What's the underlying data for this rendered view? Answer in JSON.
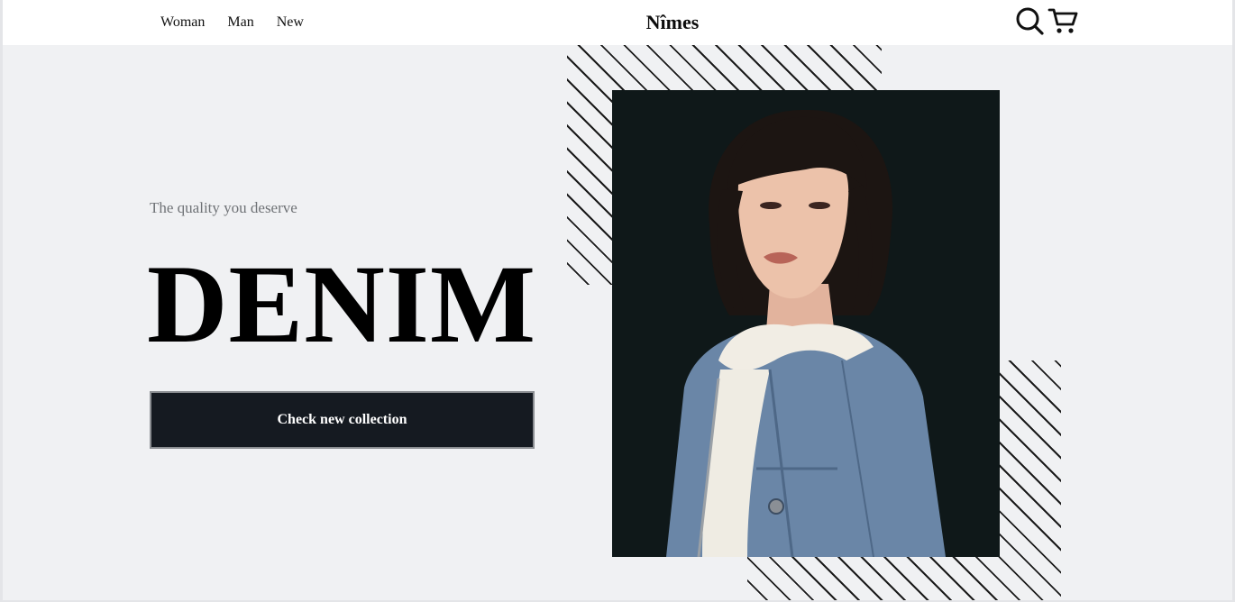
{
  "nav": {
    "links": [
      "Woman",
      "Man",
      "New"
    ],
    "brand": "Nîmes",
    "search_icon": "search-icon",
    "cart_icon": "cart-icon"
  },
  "hero": {
    "subtitle": "The quality you deserve",
    "title": "DENIM",
    "cta_label": "Check new collection"
  },
  "image": {
    "subject": "model-portrait",
    "background_color": "#0f1819"
  },
  "colors": {
    "page_bg": "#f0f1f3",
    "nav_bg": "#ffffff",
    "cta_bg": "#151a21",
    "text_muted": "#6f7276"
  }
}
